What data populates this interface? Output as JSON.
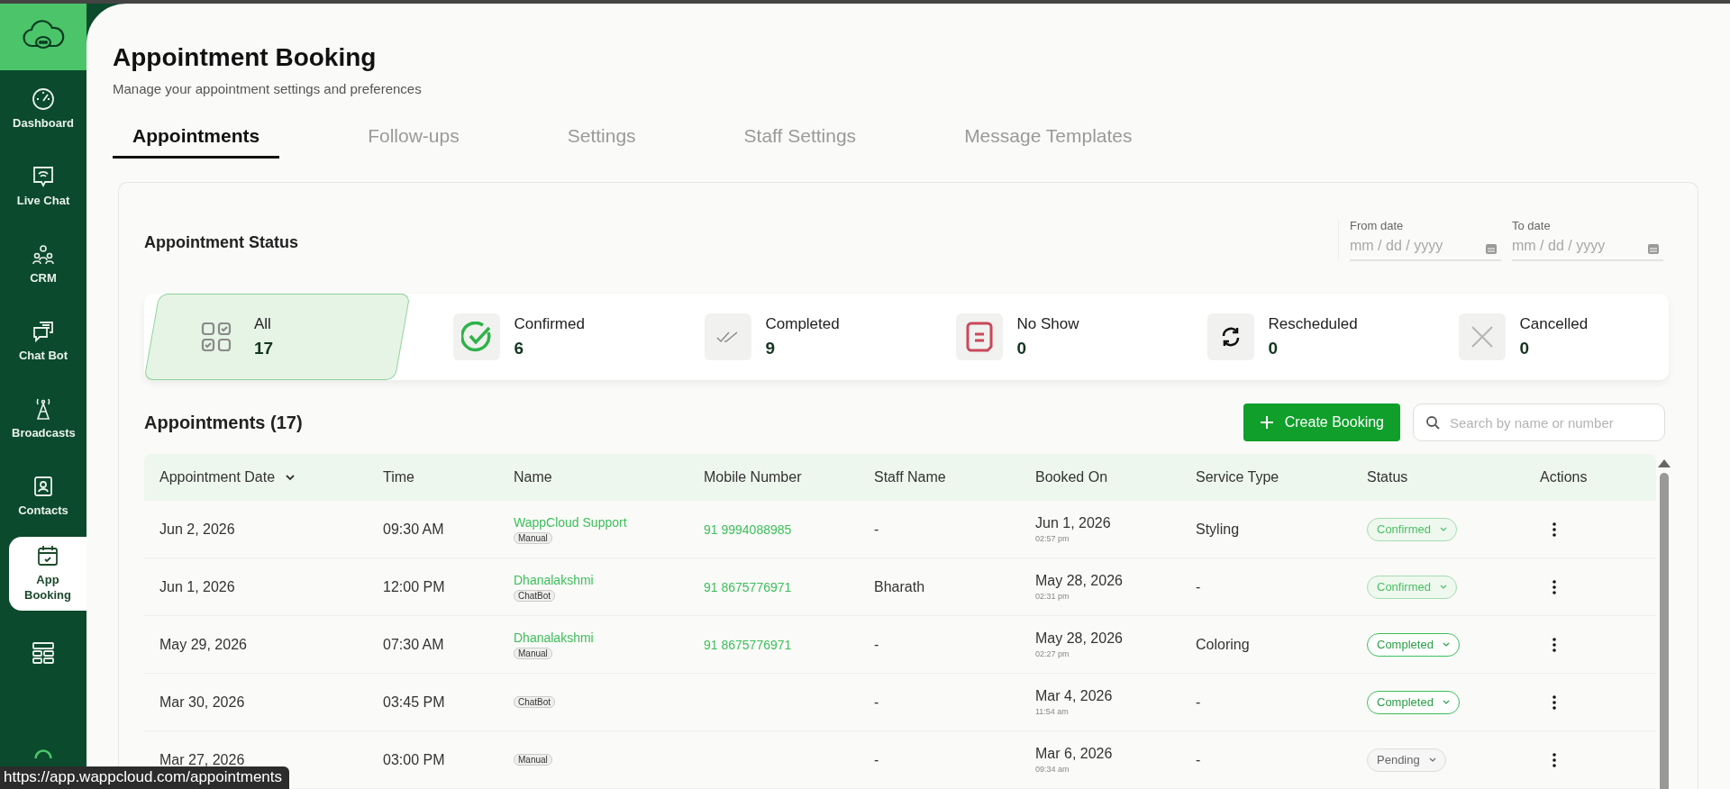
{
  "sidebar": {
    "items": [
      {
        "label": "Dashboard",
        "kind": "gauge",
        "selected": false
      },
      {
        "label": "Live Chat",
        "kind": "chat",
        "selected": false
      },
      {
        "label": "CRM",
        "kind": "people",
        "selected": false
      },
      {
        "label": "Chat Bot",
        "kind": "bot",
        "selected": false
      },
      {
        "label": "Broadcasts",
        "kind": "tower",
        "selected": false
      },
      {
        "label": "Contacts",
        "kind": "contact",
        "selected": false
      },
      {
        "label": "App Booking",
        "kind": "calendar",
        "selected": true
      },
      {
        "kind": "layout",
        "selected": false
      }
    ]
  },
  "page": {
    "title": "Appointment Booking",
    "subtitle": "Manage your appointment settings and preferences"
  },
  "tabs": [
    {
      "label": "Appointments",
      "selected": true
    },
    {
      "label": "Follow-ups",
      "selected": false
    },
    {
      "label": "Settings",
      "selected": false
    },
    {
      "label": "Staff Settings",
      "selected": false
    },
    {
      "label": "Message Templates",
      "selected": false
    }
  ],
  "status_section": {
    "title": "Appointment Status",
    "from_date": {
      "label": "From date",
      "placeholder": "mm / dd / yyyy"
    },
    "to_date": {
      "label": "To date",
      "placeholder": "mm / dd / yyyy"
    }
  },
  "status_cards": [
    {
      "kind": "all",
      "label": "All",
      "count": "17",
      "selected": true
    },
    {
      "kind": "confirmed",
      "label": "Confirmed",
      "count": "6",
      "selected": false
    },
    {
      "kind": "completed",
      "label": "Completed",
      "count": "9",
      "selected": false
    },
    {
      "kind": "noshow",
      "label": "No Show",
      "count": "0",
      "selected": false
    },
    {
      "kind": "rescheduled",
      "label": "Rescheduled",
      "count": "0",
      "selected": false
    },
    {
      "kind": "cancelled",
      "label": "Cancelled",
      "count": "0",
      "selected": false
    }
  ],
  "appointments": {
    "title": "Appointments (17)",
    "create_button": "Create Booking",
    "search": {
      "placeholder": "Search by name or number"
    },
    "columns": [
      "Appointment Date",
      "Time",
      "Name",
      "Mobile Number",
      "Staff Name",
      "Booked On",
      "Service Type",
      "Status",
      "Actions"
    ],
    "rows": [
      {
        "date": "Jun 2, 2026",
        "time": "09:30 AM",
        "name": "WappCloud Support",
        "source": "Manual",
        "mobile": "91 9994088985",
        "staff": "-",
        "booked_date": "Jun 1, 2026",
        "booked_time": "02:57 pm",
        "service": "Styling",
        "status": {
          "label": "Confirmed",
          "kind": "confirmed"
        }
      },
      {
        "date": "Jun 1, 2026",
        "time": "12:00 PM",
        "name": "Dhanalakshmi",
        "source": "ChatBot",
        "mobile": "91 8675776971",
        "staff": "Bharath",
        "booked_date": "May 28, 2026",
        "booked_time": "02:31 pm",
        "service": "-",
        "status": {
          "label": "Confirmed",
          "kind": "confirmed"
        }
      },
      {
        "date": "May 29, 2026",
        "time": "07:30 AM",
        "name": "Dhanalakshmi",
        "source": "Manual",
        "mobile": "91 8675776971",
        "staff": "-",
        "booked_date": "May 28, 2026",
        "booked_time": "02:27 pm",
        "service": "Coloring",
        "status": {
          "label": "Completed",
          "kind": "completed"
        }
      },
      {
        "date": "Mar 30, 2026",
        "time": "03:45 PM",
        "source": "ChatBot",
        "staff": "-",
        "booked_date": "Mar 4, 2026",
        "booked_time": "11:54 am",
        "service": "-",
        "status": {
          "label": "Completed",
          "kind": "completed"
        }
      },
      {
        "date": "Mar 27, 2026",
        "time": "03:00 PM",
        "source": "Manual",
        "staff": "-",
        "booked_date": "Mar 6, 2026",
        "booked_time": "09:34 am",
        "service": "-",
        "status": {
          "label": "Pending",
          "kind": "pending"
        }
      }
    ]
  },
  "status_url": "https://app.wappcloud.com/appointments"
}
